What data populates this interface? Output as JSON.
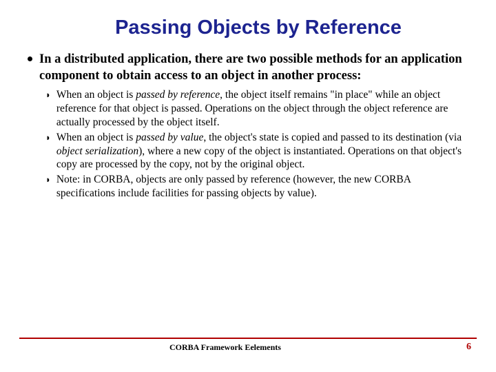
{
  "title": "Passing Objects by Reference",
  "intro": "In a distributed application, there are two possible methods for an application component to obtain access to an object in another process:",
  "sub": [
    {
      "t1": "When an object is ",
      "i1": "passed by reference",
      "t2": ", the object itself remains \"in place\" while an object reference for that object is passed. Operations on the object through the object reference are actually processed by the object itself."
    },
    {
      "t1": "When an object is ",
      "i1": "passed by value",
      "t2": ", the object's state is copied and passed to its destination (via ",
      "i2": "object serialization",
      "t3": "), where a new copy of the object is instantiated. Operations on that object's copy are processed by the copy, not by the original object."
    },
    {
      "t1": "Note: in CORBA, objects are only passed by reference (however, the new CORBA specifications include facilities for passing objects by value)."
    }
  ],
  "footer": "CORBA Framework Eelements",
  "page": "6"
}
